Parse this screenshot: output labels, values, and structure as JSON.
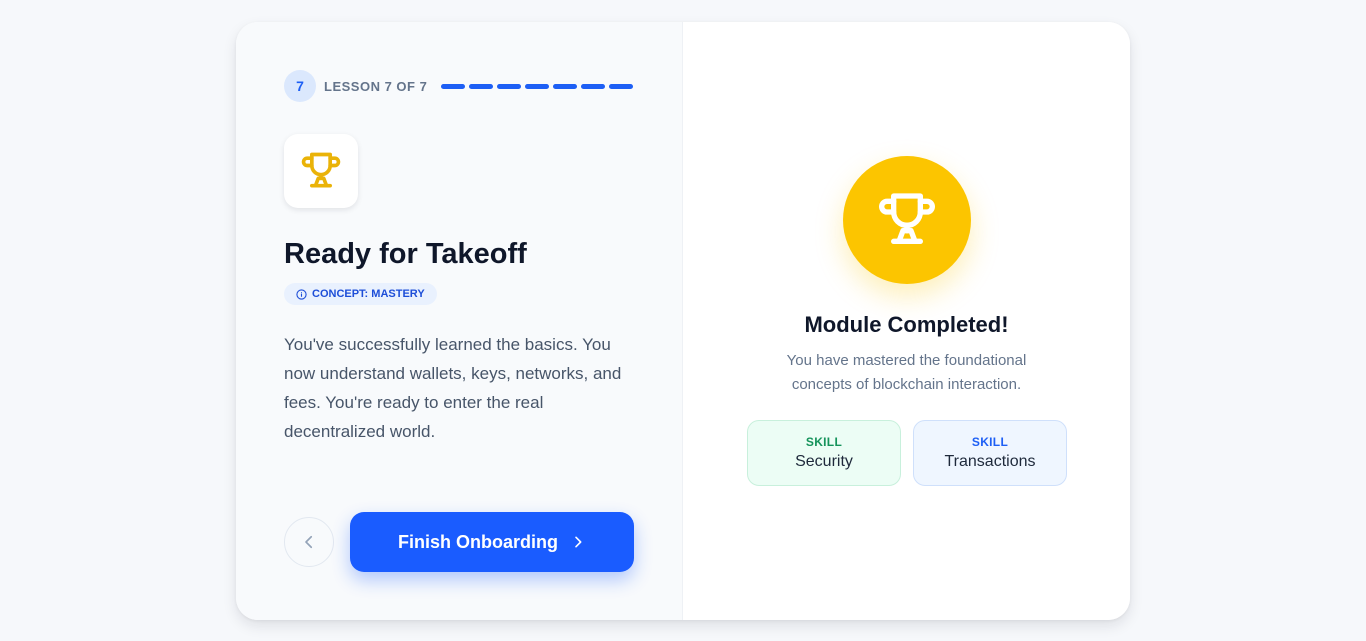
{
  "progress": {
    "step_number": "7",
    "lesson_label": "LESSON 7 OF 7",
    "total_segments": 7,
    "completed_segments": 7
  },
  "lesson": {
    "icon": "trophy-icon",
    "title": "Ready for Takeoff",
    "concept_label": "CONCEPT: MASTERY",
    "description": "You've successfully learned the basics. You now understand wallets, keys, networks, and fees. You're ready to enter the real decentralized world."
  },
  "nav": {
    "back_icon": "chevron-left-icon",
    "finish_label": "Finish Onboarding",
    "finish_icon": "chevron-right-icon"
  },
  "completion": {
    "icon": "trophy-icon",
    "title": "Module Completed!",
    "subtitle": "You have mastered the foundational concepts of blockchain interaction.",
    "skills": [
      {
        "tag": "SKILL",
        "name": "Security",
        "color": "#15935b"
      },
      {
        "tag": "SKILL",
        "name": "Transactions",
        "color": "#1d5ff5"
      }
    ]
  },
  "colors": {
    "primary": "#1a5cff",
    "accent_gold": "#fcc500",
    "heading": "#0f172a",
    "muted": "#64748b"
  }
}
